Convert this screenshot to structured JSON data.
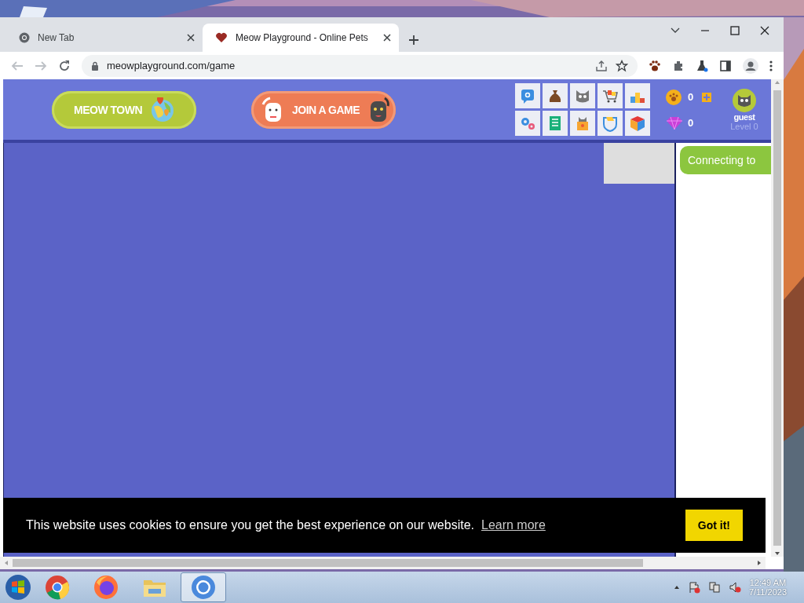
{
  "browser": {
    "tabs": [
      {
        "title": "New Tab",
        "kind": "newtab",
        "selected": false
      },
      {
        "title": "Meow Playground - Online Pets",
        "kind": "site",
        "selected": true
      }
    ],
    "address": "meowplayground.com/game"
  },
  "game": {
    "nav_buttons": [
      {
        "label": "MEOW TOWN",
        "kind": "town"
      },
      {
        "label": "JOIN A GAME",
        "kind": "join"
      }
    ],
    "currency": [
      {
        "kind": "coins",
        "amount": "0"
      },
      {
        "kind": "gems",
        "amount": "0"
      }
    ],
    "user": {
      "name": "guest",
      "level": "Level 0"
    },
    "status": "Connecting to"
  },
  "cookie_banner": {
    "message": "This website uses cookies to ensure you get the best experience on our website.",
    "link": "Learn more",
    "button": "Got it!"
  },
  "taskbar": {
    "apps": [
      {
        "kind": "chrome",
        "selected": false
      },
      {
        "kind": "firefox",
        "selected": false
      },
      {
        "kind": "folder",
        "selected": false
      },
      {
        "kind": "chromium",
        "selected": true
      }
    ],
    "time": "12:49 AM",
    "date": "7/11/2023"
  }
}
